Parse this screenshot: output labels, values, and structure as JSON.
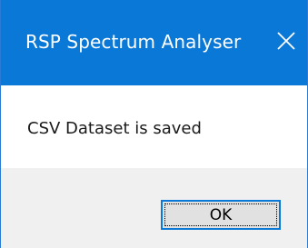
{
  "window": {
    "title": "RSP Spectrum Analyser",
    "close_icon": "close-icon"
  },
  "dialog": {
    "message": "CSV Dataset is saved",
    "ok_label": "OK"
  },
  "colors": {
    "titlebar": "#0a78d7",
    "footer": "#f0f0f0",
    "button_border": "#0a78d7",
    "button_face": "#e1e1e1"
  }
}
